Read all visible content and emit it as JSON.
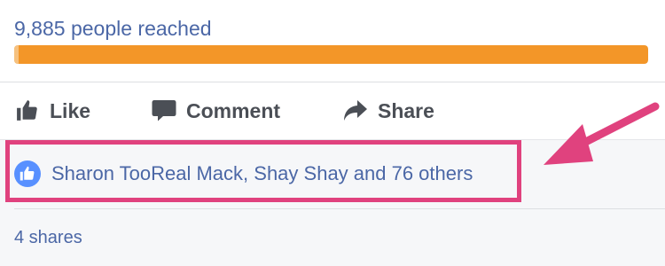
{
  "post_stats": {
    "reach_text": "9,885 people reached",
    "reach_progress_percent": 100
  },
  "actions": {
    "like_label": "Like",
    "comment_label": "Comment",
    "share_label": "Share"
  },
  "reactions": {
    "names_text": "Sharon TooReal Mack, Shay Shay and 76 others",
    "icon": "like-thumb-icon"
  },
  "shares": {
    "text": "4 shares"
  },
  "annotation": {
    "highlight_color": "#e0427e",
    "arrow_color": "#e0427e"
  },
  "colors": {
    "link_blue": "#4b67a6",
    "progress_orange": "#f39628",
    "action_gray": "#4b4f56",
    "like_badge_blue": "#5890ff"
  }
}
